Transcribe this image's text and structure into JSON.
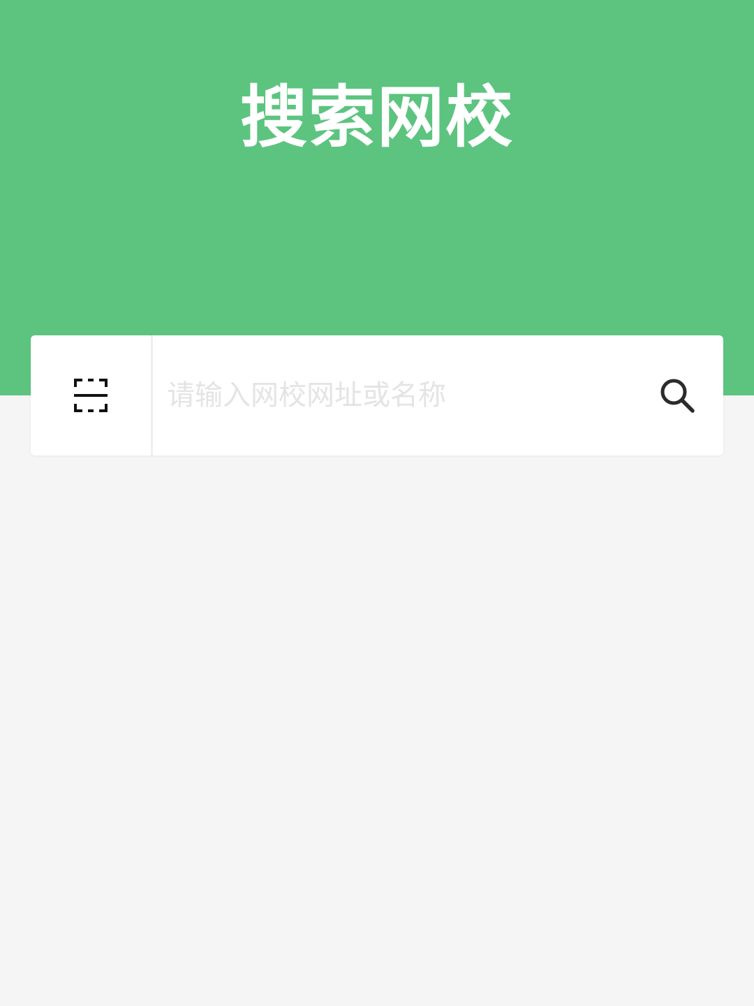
{
  "header": {
    "title": "搜索网校",
    "background_color": "#5cc47f"
  },
  "search": {
    "placeholder": "请输入网校网址或名称",
    "value": "",
    "scan_icon": "scan-icon",
    "search_icon": "search-icon"
  },
  "page": {
    "background_color": "#f5f5f5"
  }
}
